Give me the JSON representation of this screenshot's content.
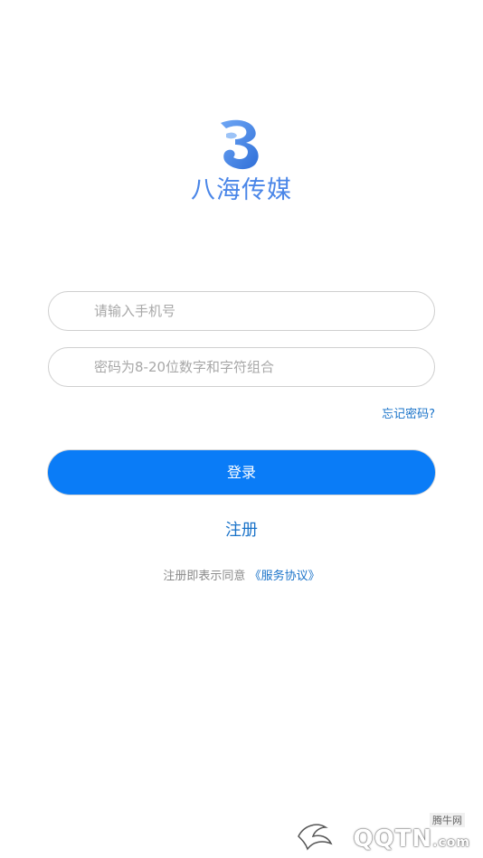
{
  "brand": {
    "logo_icon": "butterfly-b-logo-icon",
    "name": "八海传媒",
    "color": "#4a86e8"
  },
  "form": {
    "phone_placeholder": "请输入手机号",
    "phone_value": "",
    "password_placeholder": "密码为8-20位数字和字符组合",
    "password_value": "",
    "forgot_label": "忘记密码?",
    "login_label": "登录",
    "register_label": "注册"
  },
  "agreement": {
    "prefix": "注册即表示同意",
    "link_label": "《服务协议》"
  },
  "watermark": {
    "small": "腾牛网",
    "big": "QQTN",
    "suffix": ".com"
  },
  "colors": {
    "accent": "#0a7cf7",
    "link": "#1a73c9",
    "field_border": "#cfcfcf",
    "placeholder": "#a8a8a8"
  }
}
